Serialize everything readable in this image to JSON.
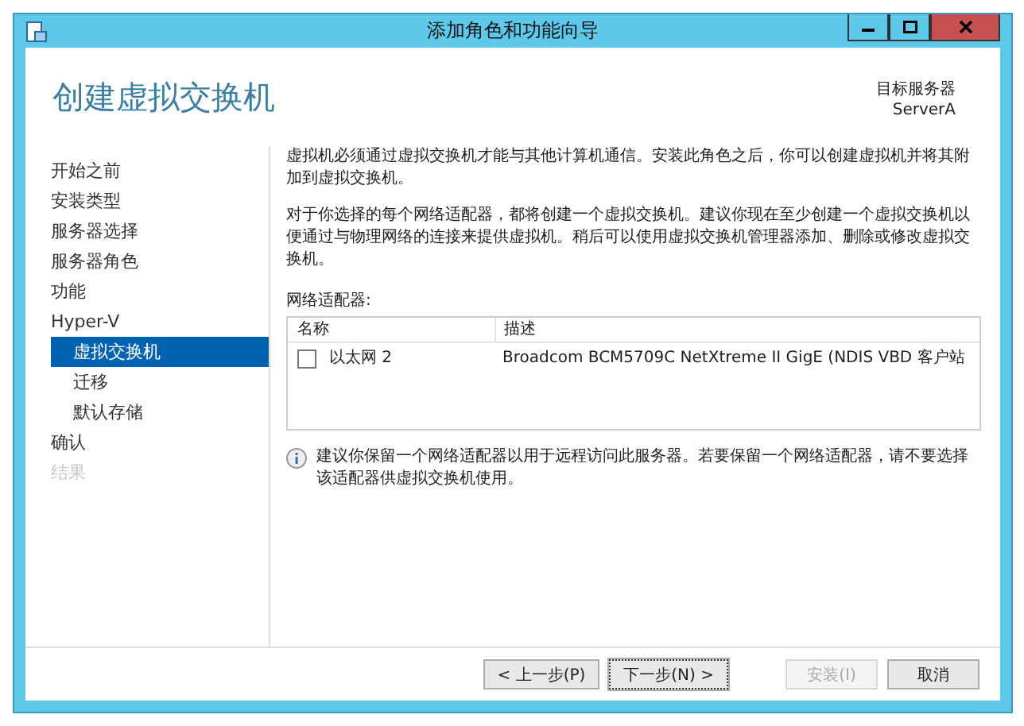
{
  "window": {
    "title": "添加角色和功能向导"
  },
  "header": {
    "title": "创建虚拟交换机",
    "target_label": "目标服务器",
    "target_value": "ServerA"
  },
  "sidebar": {
    "items": [
      {
        "label": "开始之前",
        "selected": false,
        "disabled": false
      },
      {
        "label": "安装类型",
        "selected": false,
        "disabled": false
      },
      {
        "label": "服务器选择",
        "selected": false,
        "disabled": false
      },
      {
        "label": "服务器角色",
        "selected": false,
        "disabled": false
      },
      {
        "label": "功能",
        "selected": false,
        "disabled": false
      },
      {
        "label": "Hyper-V",
        "selected": false,
        "disabled": false,
        "children": [
          {
            "label": "虚拟交换机",
            "selected": true,
            "disabled": false
          },
          {
            "label": "迁移",
            "selected": false,
            "disabled": false
          },
          {
            "label": "默认存储",
            "selected": false,
            "disabled": false
          }
        ]
      },
      {
        "label": "确认",
        "selected": false,
        "disabled": false
      },
      {
        "label": "结果",
        "selected": false,
        "disabled": true
      }
    ]
  },
  "content": {
    "paragraphs": [
      "虚拟机必须通过虚拟交换机才能与其他计算机通信。安装此角色之后，你可以创建虚拟机并将其附加到虚拟交换机。",
      "对于你选择的每个网络适配器，都将创建一个虚拟交换机。建议你现在至少创建一个虚拟交换机以便通过与物理网络的连接来提供虚拟机。稍后可以使用虚拟交换机管理器添加、删除或修改虚拟交换机。"
    ],
    "adapters_label": "网络适配器:",
    "table": {
      "columns": [
        "名称",
        "描述"
      ],
      "rows": [
        {
          "name": "以太网 2",
          "description": "Broadcom BCM5709C NetXtreme II GigE (NDIS VBD 客户站",
          "checked": false
        }
      ]
    },
    "info": "建议你保留一个网络适配器以用于远程访问此服务器。若要保留一个网络适配器，请不要选择该适配器供虚拟交换机使用。"
  },
  "buttons": [
    {
      "label": "< 上一步(P)",
      "disabled": false,
      "focused": false
    },
    {
      "label": "下一步(N) >",
      "disabled": false,
      "focused": true
    },
    {
      "label": "安装(I)",
      "disabled": true,
      "focused": false
    },
    {
      "label": "取消",
      "disabled": false,
      "focused": false
    }
  ]
}
